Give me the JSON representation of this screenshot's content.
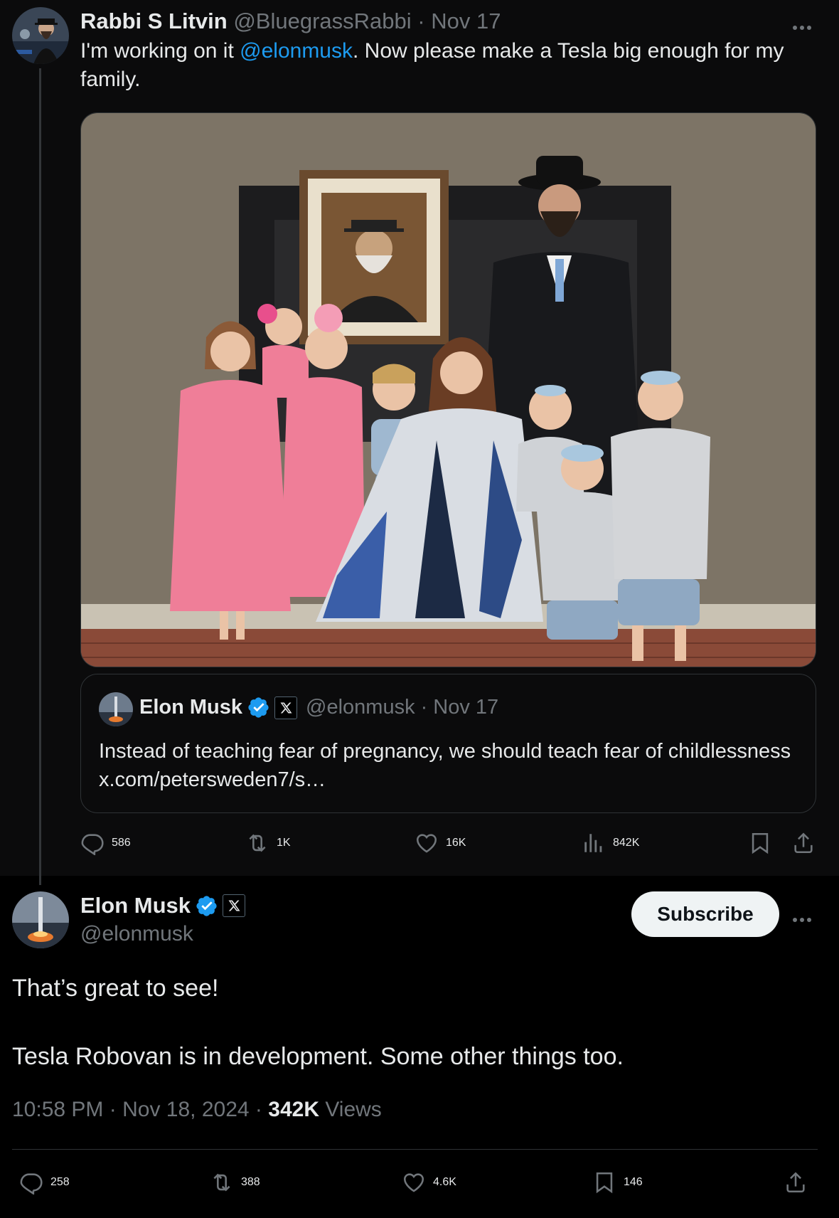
{
  "colors": {
    "accent": "#1d9bf0",
    "muted": "#71767b",
    "text": "#e7e9ea",
    "background": "#000000",
    "panel": "#0b0b0c"
  },
  "parent_tweet": {
    "author_name": "Rabbi S Litvin",
    "handle": "@BluegrassRabbi",
    "separator": "·",
    "date": "Nov 17",
    "text_before": "I'm working on it ",
    "mention": "@elonmusk",
    "text_after": ". Now please make a Tesla big enough for my family.",
    "quoted": {
      "author_name": "Elon Musk",
      "handle": "@elonmusk",
      "separator": "·",
      "date": "Nov 17",
      "text": "Instead of teaching fear of pregnancy, we should teach fear of childlessness x.com/petersweden7/s…"
    },
    "actions": {
      "replies": "586",
      "reposts": "1K",
      "likes": "16K",
      "views": "842K"
    }
  },
  "main_tweet": {
    "author_name": "Elon Musk",
    "handle": "@elonmusk",
    "subscribe_label": "Subscribe",
    "text_line1": "That’s great to see!",
    "text_line2": "Tesla Robovan is in development. Some other things too.",
    "time": "10:58 PM",
    "meta_separator": "·",
    "date": "Nov 18, 2024",
    "views_count": "342K",
    "views_label": "Views",
    "actions": {
      "replies": "258",
      "reposts": "388",
      "likes": "4.6K",
      "bookmarks": "146"
    }
  },
  "icons": [
    "more-icon",
    "verified-badge-icon",
    "x-affiliate-icon",
    "reply-icon",
    "repost-icon",
    "like-icon",
    "views-icon",
    "bookmark-icon",
    "share-icon"
  ]
}
